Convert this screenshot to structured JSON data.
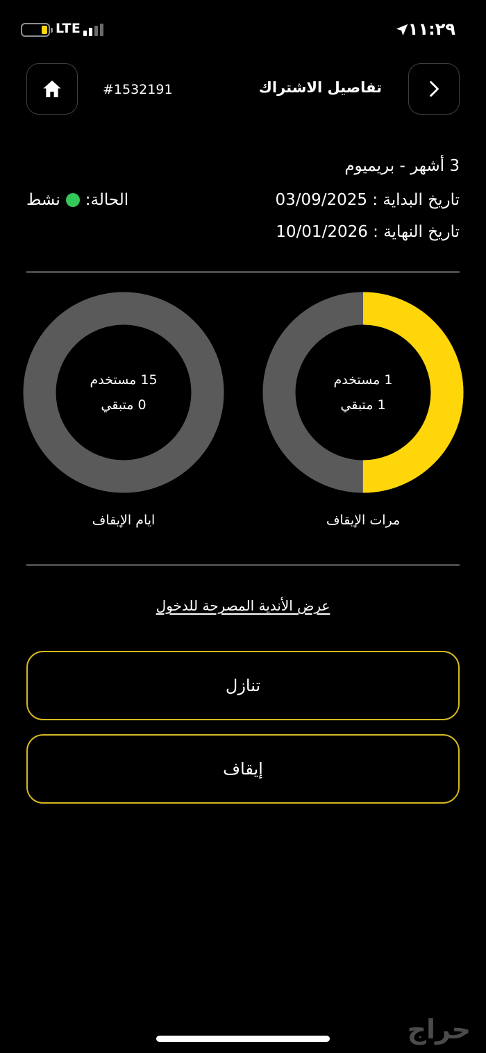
{
  "status_bar": {
    "network": "LTE",
    "time": "١١:٢٩",
    "battery_level": 0.2,
    "signal_bars": 2
  },
  "header": {
    "subscription_id": "#1532191",
    "title": "تفاصيل الاشتراك"
  },
  "subscription": {
    "plan": "3 أشهر - بريميوم",
    "start_date_text": "تاريخ البداية : 03/09/2025",
    "end_date_text": "تاريخ النهاية : 10/01/2026",
    "status_label": "الحالة:",
    "status_value": "نشط"
  },
  "freeze_counts": {
    "label": "مرات الإيقاف",
    "used_text": "1 مستخدم",
    "remaining_text": "1 متبقي",
    "used": 1,
    "remaining": 1
  },
  "freeze_days": {
    "label": "ايام الإيقاف",
    "used_text": "15 مستخدم",
    "remaining_text": "0 متبقي",
    "used": 15,
    "remaining": 0
  },
  "links": {
    "clubs": "عرض الأندية المصرحة للدخول"
  },
  "buttons": {
    "transfer": "تنازل",
    "freeze": "إيقاف"
  },
  "watermark": "حراج",
  "colors": {
    "accent": "#ffd60a",
    "ring_track": "#5a5a5a",
    "status_active": "#34c759",
    "button_border": "#d4b820"
  }
}
